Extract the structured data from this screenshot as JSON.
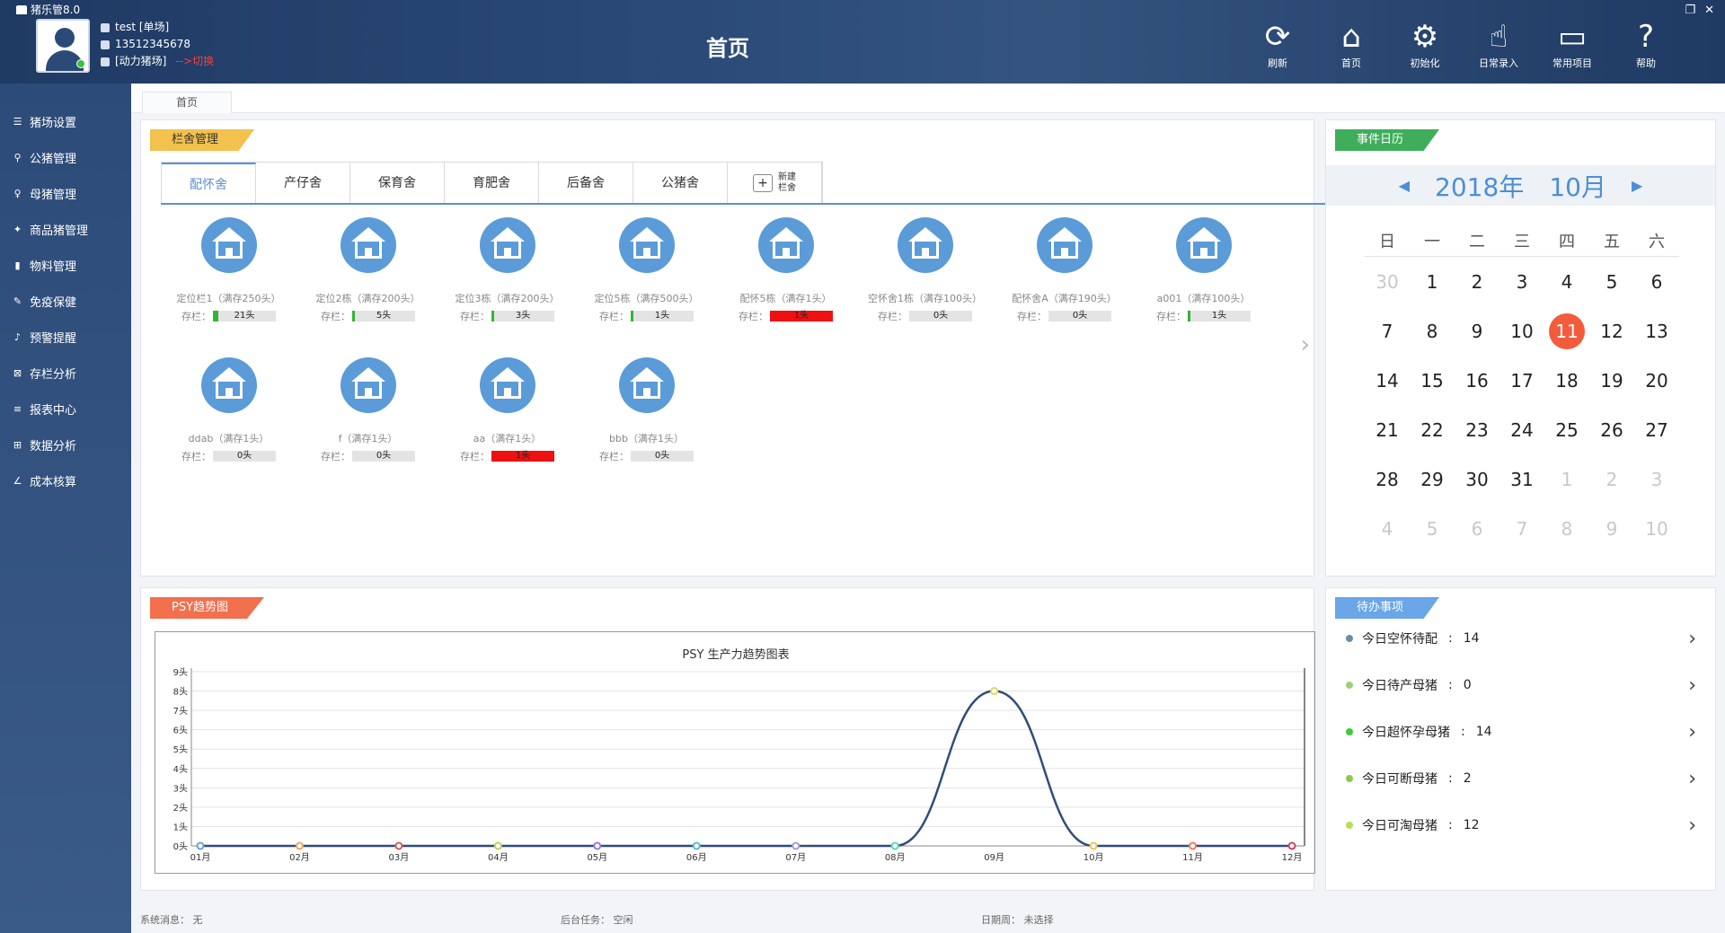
{
  "app": {
    "title": "猪乐管8.0"
  },
  "user": {
    "name": "test [单场]",
    "phone": "13512345678",
    "farm": "[动力猪场]",
    "switch_label": "-->切换"
  },
  "header": {
    "title": "首页"
  },
  "toolbar": [
    {
      "label": "刷新",
      "icon": "refresh-icon"
    },
    {
      "label": "首页",
      "icon": "home-icon"
    },
    {
      "label": "初始化",
      "icon": "gear-icon"
    },
    {
      "label": "日常录入",
      "icon": "hand-icon"
    },
    {
      "label": "常用项目",
      "icon": "folder-icon"
    },
    {
      "label": "帮助",
      "icon": "help-icon"
    }
  ],
  "sidebar": [
    {
      "label": "猪场设置",
      "icon": "farm-settings-icon"
    },
    {
      "label": "公猪管理",
      "icon": "boar-icon"
    },
    {
      "label": "母猪管理",
      "icon": "sow-icon"
    },
    {
      "label": "商品猪管理",
      "icon": "pig-icon"
    },
    {
      "label": "物料管理",
      "icon": "material-icon"
    },
    {
      "label": "免疫保健",
      "icon": "syringe-icon"
    },
    {
      "label": "预警提醒",
      "icon": "bell-icon"
    },
    {
      "label": "存栏分析",
      "icon": "analysis-icon"
    },
    {
      "label": "报表中心",
      "icon": "report-icon"
    },
    {
      "label": "数据分析",
      "icon": "data-icon"
    },
    {
      "label": "成本核算",
      "icon": "cost-icon"
    }
  ],
  "breadcrumb": "首页",
  "pens": {
    "title": "栏舍管理",
    "tabs": [
      "配怀舍",
      "产仔舍",
      "保育舍",
      "育肥舍",
      "后备舍",
      "公猪舍"
    ],
    "new_tab": [
      "新建",
      "栏舍"
    ],
    "stock_label": "存栏：",
    "items": [
      {
        "name": "定位栏1（满存250头）",
        "stock": "21头",
        "fill": 0.084
      },
      {
        "name": "定位2栋（满存200头）",
        "stock": "5头",
        "fill": 0.025
      },
      {
        "name": "定位3栋（满存200头）",
        "stock": "3头",
        "fill": 0.015
      },
      {
        "name": "定位5栋（满存500头）",
        "stock": "1头",
        "fill": 0.002
      },
      {
        "name": "配怀5栋（满存1头）",
        "stock": "1头",
        "fill": 1
      },
      {
        "name": "空怀舍1栋（满存100头）",
        "stock": "0头",
        "fill": 0
      },
      {
        "name": "配怀舍A（满存190头）",
        "stock": "0头",
        "fill": 0
      },
      {
        "name": "a001（满存100头）",
        "stock": "1头",
        "fill": 0.01
      },
      {
        "name": "ddab（满存1头）",
        "stock": "0头",
        "fill": 0
      },
      {
        "name": "f（满存1头）",
        "stock": "0头",
        "fill": 0
      },
      {
        "name": "aa（满存1头）",
        "stock": "1头",
        "fill": 1
      },
      {
        "name": "bbb（满存1头）",
        "stock": "0头",
        "fill": 0
      }
    ]
  },
  "calendar": {
    "title": "事件日历",
    "year": "2018年",
    "month": "10月",
    "weekdays": [
      "日",
      "一",
      "二",
      "三",
      "四",
      "五",
      "六"
    ],
    "weeks": [
      [
        [
          "30",
          1
        ],
        [
          "1",
          0
        ],
        [
          "2",
          0
        ],
        [
          "3",
          0
        ],
        [
          "4",
          0
        ],
        [
          "5",
          0
        ],
        [
          "6",
          0
        ]
      ],
      [
        [
          "7",
          0
        ],
        [
          "8",
          0
        ],
        [
          "9",
          0
        ],
        [
          "10",
          0
        ],
        [
          "11",
          2
        ],
        [
          "12",
          0
        ],
        [
          "13",
          0
        ]
      ],
      [
        [
          "14",
          0
        ],
        [
          "15",
          0
        ],
        [
          "16",
          0
        ],
        [
          "17",
          0
        ],
        [
          "18",
          0
        ],
        [
          "19",
          0
        ],
        [
          "20",
          0
        ]
      ],
      [
        [
          "21",
          0
        ],
        [
          "22",
          0
        ],
        [
          "23",
          0
        ],
        [
          "24",
          0
        ],
        [
          "25",
          0
        ],
        [
          "26",
          0
        ],
        [
          "27",
          0
        ]
      ],
      [
        [
          "28",
          0
        ],
        [
          "29",
          0
        ],
        [
          "30",
          0
        ],
        [
          "31",
          0
        ],
        [
          "1",
          1
        ],
        [
          "2",
          1
        ],
        [
          "3",
          1
        ]
      ],
      [
        [
          "4",
          1
        ],
        [
          "5",
          1
        ],
        [
          "6",
          1
        ],
        [
          "7",
          1
        ],
        [
          "8",
          1
        ],
        [
          "9",
          1
        ],
        [
          "10",
          1
        ]
      ]
    ]
  },
  "psy": {
    "tag": "PSY趋势图",
    "chart_title": "PSY 生产力趋势图表"
  },
  "chart_data": {
    "type": "line",
    "title": "PSY 生产力趋势图表",
    "categories": [
      "01月",
      "02月",
      "03月",
      "04月",
      "05月",
      "06月",
      "07月",
      "08月",
      "09月",
      "10月",
      "11月",
      "12月"
    ],
    "series": [
      {
        "values": [
          0,
          0,
          0,
          0,
          0,
          0,
          0,
          0,
          8,
          0,
          0,
          0
        ]
      }
    ],
    "y_ticks": [
      "0头",
      "1头",
      "2头",
      "3头",
      "4头",
      "5头",
      "6头",
      "7头",
      "8头",
      "9头"
    ],
    "ylim": [
      0,
      9
    ],
    "point_colors": [
      "#6aa0d8",
      "#f2a25c",
      "#d65c5c",
      "#b7d65c",
      "#9b7ad6",
      "#5cb8d6",
      "#a0a0d6",
      "#5cd6c0",
      "#e6d65c",
      "#f2c25c",
      "#f27a5c",
      "#d6405c"
    ],
    "line_color": "#2e4e78",
    "grid": true
  },
  "todo": {
    "title": "待办事项",
    "items": [
      {
        "label": "今日空怀待配",
        "value": "14",
        "color": "#6a8ea8"
      },
      {
        "label": "今日待产母猪",
        "value": "0",
        "color": "#9fd07a"
      },
      {
        "label": "今日超怀孕母猪",
        "value": "14",
        "color": "#3ccc3c"
      },
      {
        "label": "今日可断母猪",
        "value": "2",
        "color": "#8cc850"
      },
      {
        "label": "今日可淘母猪",
        "value": "12",
        "color": "#b8dc5c"
      }
    ],
    "separator": ":"
  },
  "status": {
    "msg_label": "系统消息：",
    "msg_value": "无",
    "task_label": "后台任务：",
    "task_value": "空闲",
    "period_label": "日期周：",
    "period_value": "未选择"
  },
  "colors": {
    "accent": "#5b8fd6",
    "today": "#f25c3c",
    "header": "#2b4a78",
    "pen_tag": "#f2c14e",
    "cal_tag": "#3fae5c",
    "psy_tag": "#f2704e",
    "todo_tag": "#6aa6e8"
  }
}
